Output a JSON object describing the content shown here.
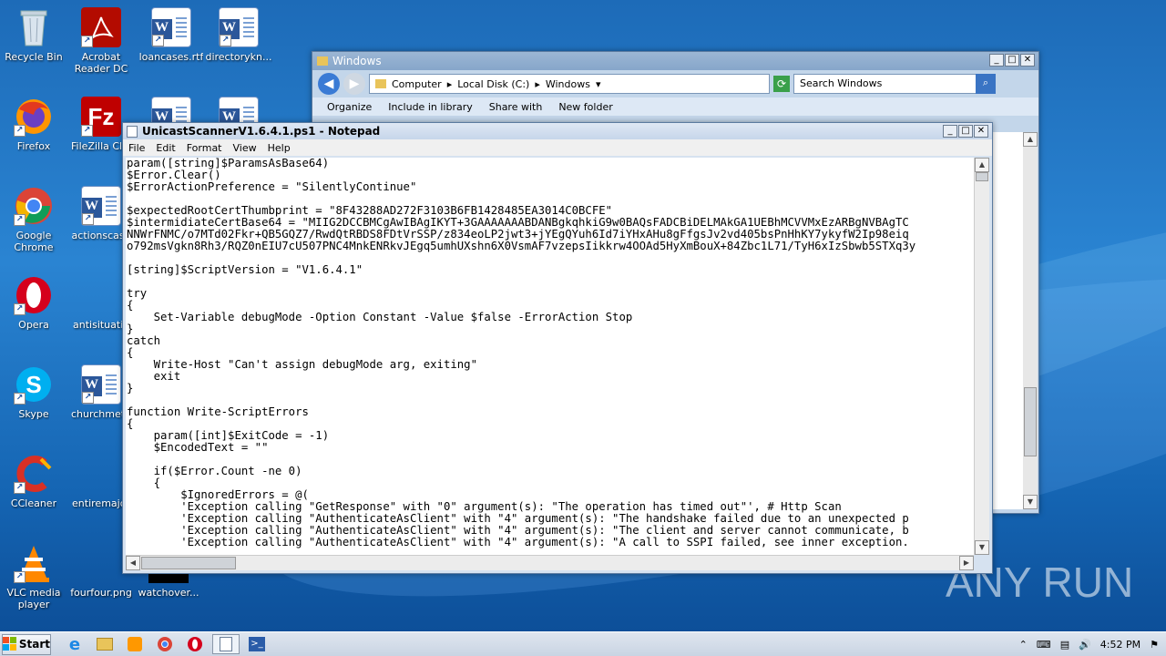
{
  "desktop": {
    "icons": [
      {
        "label": "Recycle Bin"
      },
      {
        "label": "Acrobat Reader DC"
      },
      {
        "label": "loancases.rtf"
      },
      {
        "label": "directorykn..."
      },
      {
        "label": "Firefox"
      },
      {
        "label": "FileZilla Clie"
      },
      {
        "label": "Google Chrome"
      },
      {
        "label": "actionscase"
      },
      {
        "label": "Opera"
      },
      {
        "label": "antisituatio"
      },
      {
        "label": "Skype"
      },
      {
        "label": "churchmeth"
      },
      {
        "label": "CCleaner"
      },
      {
        "label": "entiremajor"
      },
      {
        "label": "VLC media player"
      },
      {
        "label": "fourfour.png"
      },
      {
        "label": "watchover..."
      }
    ],
    "watermark": "ANY RUN"
  },
  "explorer": {
    "title": "Windows",
    "breadcrumb": [
      "Computer",
      "Local Disk (C:)",
      "Windows"
    ],
    "search_placeholder": "Search Windows",
    "toolbar": [
      "Organize",
      "Include in library",
      "Share with",
      "New folder"
    ]
  },
  "notepad": {
    "title": "UnicastScannerV1.6.4.1.ps1 - Notepad",
    "menu": [
      "File",
      "Edit",
      "Format",
      "View",
      "Help"
    ],
    "lines": [
      "param([string]$ParamsAsBase64)",
      "$Error.Clear()",
      "$ErrorActionPreference = \"SilentlyContinue\"",
      "",
      "$expectedRootCertThumbprint = \"8F43288AD272F3103B6FB1428485EA3014C0BCFE\"",
      "$intermidiateCertBase64 = \"MIIG2DCCBMCgAwIBAgIKYT+3GAAAAAAABDANBgkqhkiG9w0BAQsFADCBiDELMAkGA1UEBhMCVVMxEzARBgNVBAgTC",
      "NNWrFNMC/o7MTd02Fkr+QB5GQZ7/RwdQtRBDS8FDtVrSSP/z834eoLP2jwt3+jYEgQYuh6Id7iYHxAHu8gFfgsJv2vd405bsPnHhKY7ykyfW2Ip98eiq",
      "o792msVgkn8Rh3/RQZ0nEIU7cU507PNC4MnkENRkvJEgq5umhUXshn6X0VsmAF7vzepsIikkrw4OOAd5HyXmBouX+84Zbc1L71/TyH6xIzSbwb5STXq3y",
      "",
      "[string]$ScriptVersion = \"V1.6.4.1\"",
      "",
      "try",
      "{",
      "    Set-Variable debugMode -Option Constant -Value $false -ErrorAction Stop",
      "}",
      "catch",
      "{",
      "    Write-Host \"Can't assign debugMode arg, exiting\"",
      "    exit",
      "}",
      "",
      "function Write-ScriptErrors",
      "{",
      "    param([int]$ExitCode = -1)",
      "    $EncodedText = \"\"",
      "",
      "    if($Error.Count -ne 0)",
      "    {",
      "        $IgnoredErrors = @(",
      "        'Exception calling \"GetResponse\" with \"0\" argument(s): \"The operation has timed out\"', # Http Scan",
      "        'Exception calling \"AuthenticateAsClient\" with \"4\" argument(s): \"The handshake failed due to an unexpected p",
      "        'Exception calling \"AuthenticateAsClient\" with \"4\" argument(s): \"The client and server cannot communicate, b",
      "        'Exception calling \"AuthenticateAsClient\" with \"4\" argument(s): \"A call to SSPI failed, see inner exception."
    ]
  },
  "taskbar": {
    "start_label": "Start",
    "clock": "4:52 PM"
  }
}
